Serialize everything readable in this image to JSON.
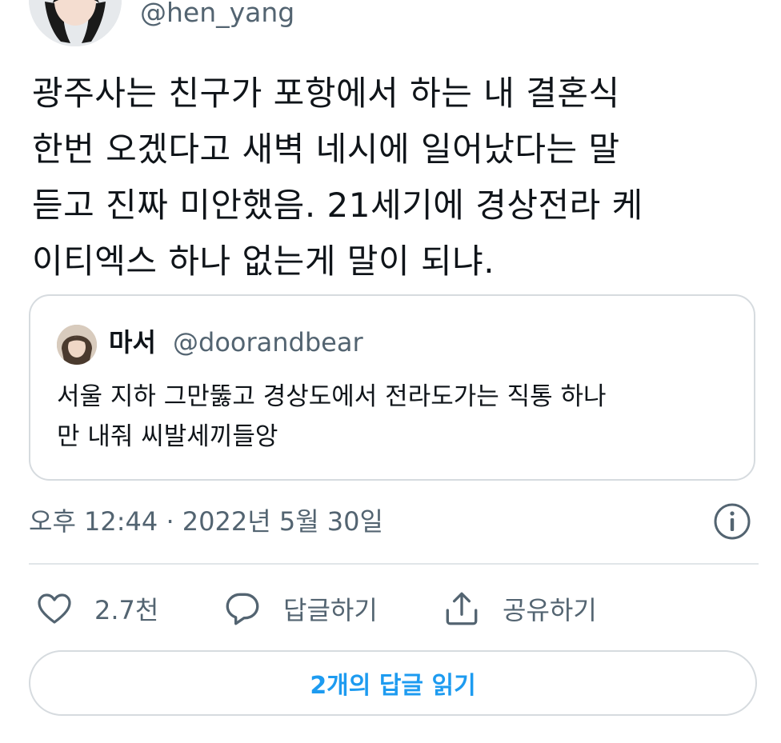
{
  "author": {
    "handle": "@hen_yang"
  },
  "tweet": {
    "lines": [
      "광주사는 친구가 포항에서 하는 내 결혼식",
      "한번 오겠다고 새벽 네시에 일어났다는 말",
      "듣고 진짜 미안했음. 21세기에 경상전라 케",
      "이티엑스 하나 없는게 말이 되냐."
    ]
  },
  "quote": {
    "name": "마서",
    "handle": "@doorandbear",
    "lines": [
      "서울 지하 그만뚫고 경상도에서 전라도가는 직통 하나",
      "만 내줘 씨발세끼들앙"
    ]
  },
  "meta": {
    "timestamp": "오후 12:44 · 2022년 5월 30일"
  },
  "actions": {
    "like": {
      "icon": "heart-icon",
      "count": "2.7천"
    },
    "reply": {
      "icon": "speech-bubble-icon",
      "label": "답글하기"
    },
    "share": {
      "icon": "share-icon",
      "label": "공유하기"
    }
  },
  "replies_button": {
    "label": "2개의 답글 읽기"
  },
  "colors": {
    "text": "#0f1419",
    "secondary": "#536471",
    "border": "#d6dbdf",
    "accent": "#1d9bf0"
  }
}
